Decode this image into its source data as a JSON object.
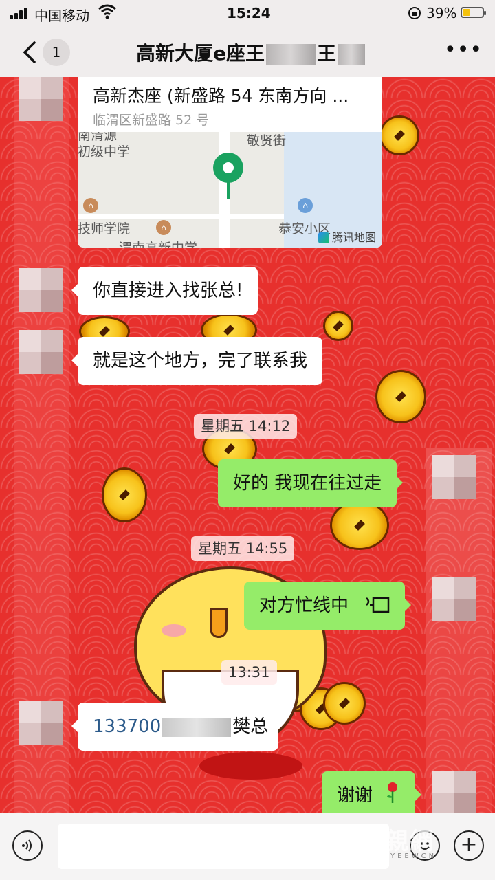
{
  "status_bar": {
    "carrier": "中国移动",
    "time": "15:24",
    "battery_percent": "39%",
    "battery_level": 0.39
  },
  "nav": {
    "unread_count": "1",
    "title_prefix": "高新大厦e座王",
    "title_middle": "王"
  },
  "location_card": {
    "title": "高新杰座 (新盛路 54 东南方向 ...",
    "address": "临渭区新盛路 52 号",
    "map_labels": [
      "南清源",
      "初级中学",
      "敬贤街",
      "技师学院",
      "恭安小区",
      "渭南高新中学"
    ],
    "map_provider": "腾讯地图"
  },
  "messages": [
    {
      "side": "left",
      "text": "你直接进入找张总!"
    },
    {
      "side": "left",
      "text": "就是这个地方，完了联系我"
    },
    {
      "side": "time",
      "text": "星期五 14:12"
    },
    {
      "side": "right",
      "text": "好的 我现在往过走"
    },
    {
      "side": "time",
      "text": "星期五 14:55"
    },
    {
      "side": "right",
      "text": "对方忙线中",
      "icon": "call-icon"
    },
    {
      "side": "time",
      "text": "13:31"
    },
    {
      "side": "left",
      "text_prefix": "133700",
      "text_suffix": "樊总"
    },
    {
      "side": "right",
      "text": "谢谢",
      "icon": "rose-icon"
    }
  ],
  "input_bar": {
    "placeholder": ""
  },
  "watermark": {
    "text": "親網",
    "sub": "YEEWCN"
  },
  "colors": {
    "chat_background": "#e7302d",
    "bubble_right": "#95ec69",
    "bubble_left": "#ffffff",
    "pin": "#1aa260"
  }
}
